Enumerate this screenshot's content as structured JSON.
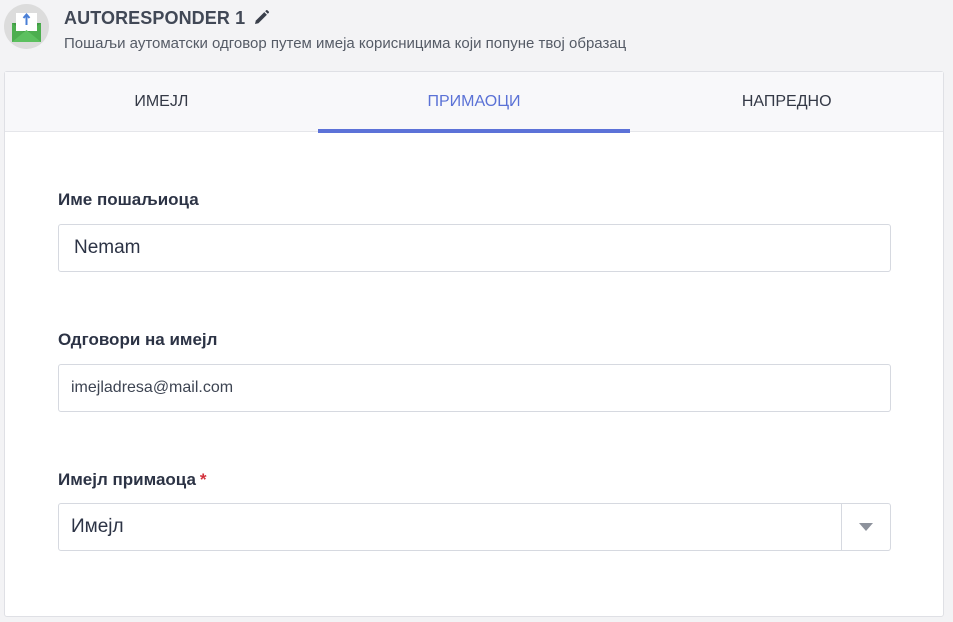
{
  "header": {
    "title": "AUTORESPONDER 1",
    "subtitle": "Пошаљи аутоматски одговор путем имеја корисницима који попуне твој образац",
    "avatar_icon": "envelope-icon",
    "edit_icon": "pencil-icon"
  },
  "tabs": [
    {
      "label": "ИМЕЈЛ",
      "active": false
    },
    {
      "label": "ПРИМАОЦИ",
      "active": true
    },
    {
      "label": "НАПРЕДНО",
      "active": false
    }
  ],
  "form": {
    "sender_name": {
      "label": "Име пошаљиоца",
      "value": "Nemam"
    },
    "reply_to": {
      "label": "Одговори на имејл",
      "value": "imejladresa@mail.com"
    },
    "recipient_email": {
      "label": "Имејл примаоца",
      "required_mark": "*",
      "value": "Имејл",
      "arrow_icon": "caret-down-icon"
    }
  },
  "colors": {
    "accent": "#5c72d8",
    "required": "#d3303b",
    "envelope": "#4cae4f"
  }
}
